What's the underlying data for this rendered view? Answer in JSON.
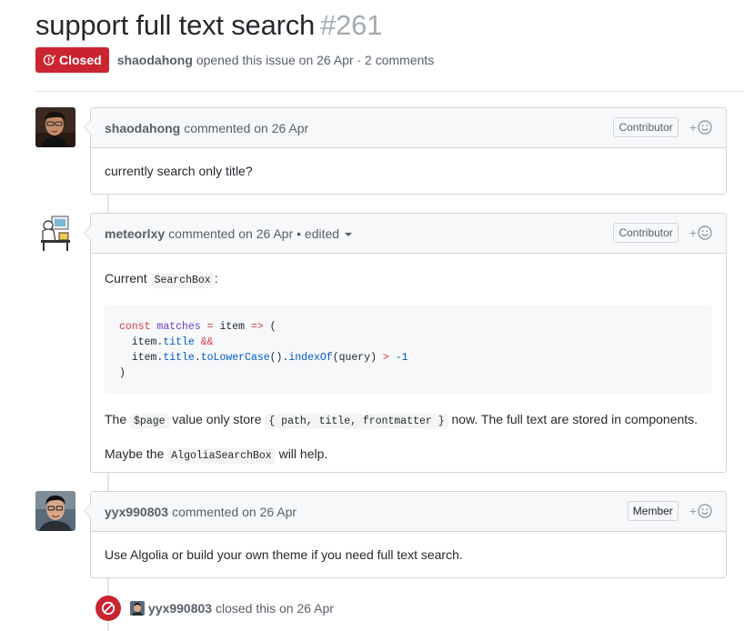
{
  "issue": {
    "title": "support full text search",
    "number": "#261",
    "state": "Closed",
    "author": "shaodahong",
    "opened_text": "opened this issue on 26 Apr · 2 comments"
  },
  "comments": [
    {
      "author": "shaodahong",
      "action": "commented on 26 Apr",
      "role": "Contributor",
      "body": "currently search only title?"
    },
    {
      "author": "meteorlxy",
      "action": "commented on 26 Apr",
      "edited": "• edited",
      "role": "Contributor",
      "body_prefix": "Current",
      "body_code": "SearchBox",
      "body_suffix": ":",
      "code_block": [
        "const matches = item => (",
        "  item.title &&",
        "  item.title.toLowerCase().indexOf(query) > -1",
        ")"
      ],
      "p2_a": "The",
      "p2_code1": "$page",
      "p2_b": "value only store",
      "p2_code2": "{ path, title, frontmatter }",
      "p2_c": "now. The full text are stored in components.",
      "p3_a": "Maybe the",
      "p3_code": "AlgoliaSearchBox",
      "p3_b": "will help."
    },
    {
      "author": "yyx990803",
      "action": "commented on 26 Apr",
      "role": "Member",
      "body": "Use Algolia or build your own theme if you need full text search."
    }
  ],
  "closed_event": {
    "actor": "yyx990803",
    "text": "closed this on 26 Apr"
  },
  "colors": {
    "closed_red": "#cb2431",
    "muted": "#586069",
    "border": "#d1d5da",
    "header_bg": "#f6f8fa"
  },
  "icons": {
    "closed_badge": "issue-closed-icon",
    "reaction": "smiley-icon",
    "dropdown": "caret-down-icon",
    "closed_event": "circle-slash-icon"
  }
}
